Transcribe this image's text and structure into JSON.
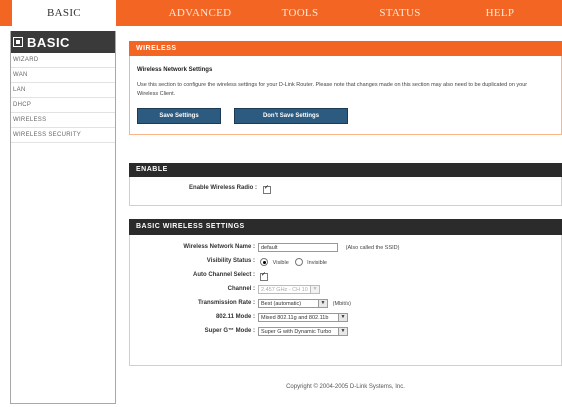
{
  "topnav": {
    "tabs": [
      {
        "label": "BASIC",
        "active": true
      },
      {
        "label": "ADVANCED",
        "active": false
      },
      {
        "label": "TOOLS",
        "active": false
      },
      {
        "label": "STATUS",
        "active": false
      },
      {
        "label": "HELP",
        "active": false
      }
    ]
  },
  "sidebar": {
    "title": "BASIC",
    "items": [
      "WIZARD",
      "WAN",
      "LAN",
      "DHCP",
      "WIRELESS",
      "WIRELESS SECURITY"
    ]
  },
  "wireless": {
    "header": "WIRELESS",
    "section_title": "Wireless Network Settings",
    "description": "Use this section to configure the wireless settings for your D-Link Router. Please note that changes made on this section may also need to be duplicated on your Wireless Client.",
    "save_label": "Save Settings",
    "dont_save_label": "Don't Save Settings"
  },
  "enable": {
    "header": "ENABLE",
    "radio_label": "Enable Wireless Radio :",
    "radio_checked": true
  },
  "basic": {
    "header": "BASIC WIRELESS SETTINGS",
    "ssid_label": "Wireless Network Name :",
    "ssid_value": "default",
    "ssid_note": "(Also called the SSID)",
    "visibility_label": "Visibility Status :",
    "visible_label": "Visible",
    "invisible_label": "Invisible",
    "visibility_selected": "Visible",
    "auto_channel_label": "Auto Channel Select :",
    "auto_channel_checked": true,
    "channel_label": "Channel :",
    "channel_value": "2.457 GHz - CH 10",
    "rate_label": "Transmission Rate :",
    "rate_value": "Best (automatic)",
    "rate_unit": "(Mbit/s)",
    "mode_label": "802.11 Mode :",
    "mode_value": "Mixed 802.11g and 802.11b",
    "superg_label": "Super G™ Mode :",
    "superg_value": "Super G with Dynamic Turbo"
  },
  "footer": {
    "copyright": "Copyright © 2004-2005 D-Link Systems, Inc."
  }
}
